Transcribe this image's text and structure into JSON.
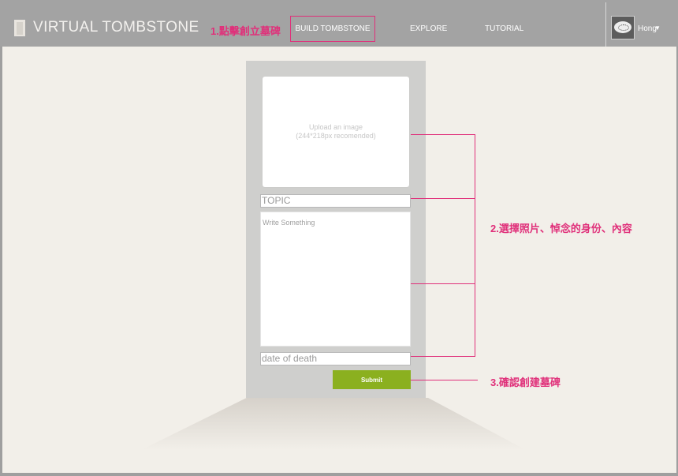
{
  "header": {
    "brand": "VIRTUAL TOMBSTONE",
    "nav": {
      "build": "BUILD TOMBSTONE",
      "explore": "EXPLORE",
      "tutorial": "TUTORIAL"
    },
    "user": {
      "name": "Hong",
      "caret": "▼"
    }
  },
  "form": {
    "upload_line1": "Upload an image",
    "upload_line2": "(244*218px recomended)",
    "topic_placeholder": "TOPIC",
    "write_placeholder": "Write Something",
    "date_placeholder": "date of death",
    "submit_label": "Submit"
  },
  "annotations": {
    "step1": "1.點擊創立墓碑",
    "step2": "2.選擇照片、悼念的身份、內容",
    "step3": "3.確認創建墓碑"
  },
  "colors": {
    "annotation": "#e0307a",
    "submit": "#8bb01f"
  },
  "icons": {
    "brand": "tombstone-icon",
    "caret": "chevron-down-icon"
  }
}
